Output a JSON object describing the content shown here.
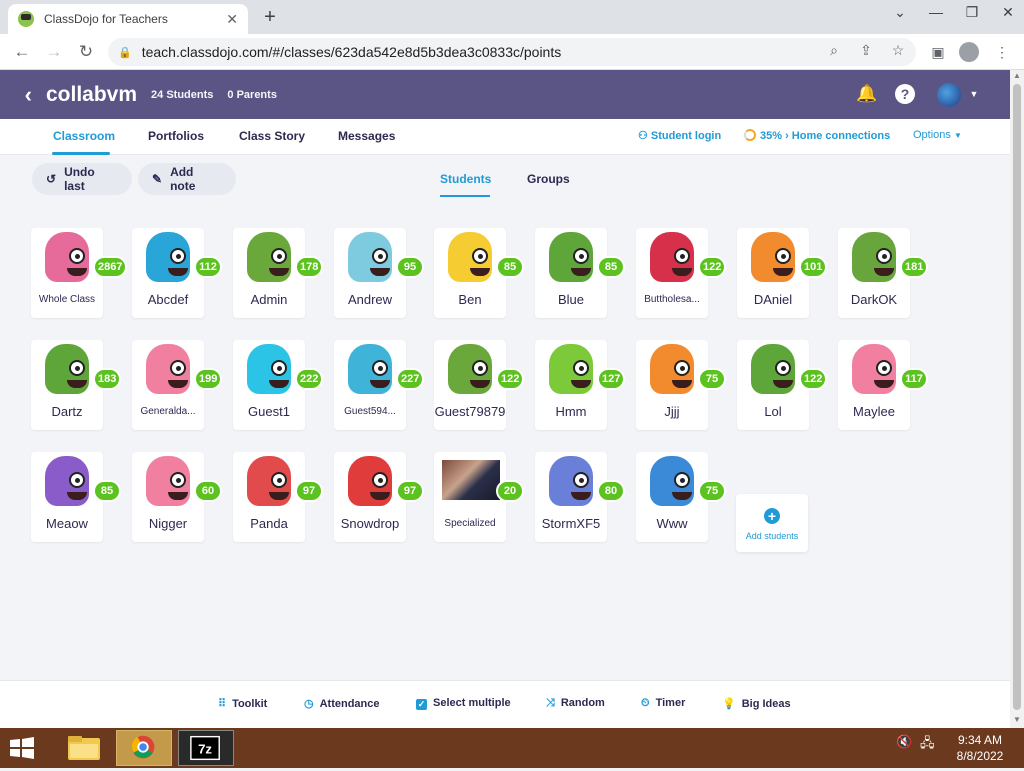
{
  "browser": {
    "tab_title": "ClassDojo for Teachers",
    "url": "teach.classdojo.com/#/classes/623da542e8d5b3dea3c0833c/points"
  },
  "app": {
    "class_name": "collabvm",
    "students_count": "24 Students",
    "parents_count": "0 Parents"
  },
  "nav": {
    "classroom": "Classroom",
    "portfolios": "Portfolios",
    "class_story": "Class Story",
    "messages": "Messages",
    "student_login": "Student login",
    "home_connections": "35% › Home connections",
    "options": "Options"
  },
  "actions": {
    "undo": "Undo last",
    "add_note": "Add note",
    "students_tab": "Students",
    "groups_tab": "Groups"
  },
  "students": [
    {
      "name": "Whole Class",
      "points": "2867",
      "color": "#e76b9a"
    },
    {
      "name": "Abcdef",
      "points": "112",
      "color": "#2aa5d8"
    },
    {
      "name": "Admin",
      "points": "178",
      "color": "#6aa83b"
    },
    {
      "name": "Andrew",
      "points": "95",
      "color": "#7ecbe0"
    },
    {
      "name": "Ben",
      "points": "85",
      "color": "#f6cc33"
    },
    {
      "name": "Blue",
      "points": "85",
      "color": "#5fa63a"
    },
    {
      "name": "Buttholesa...",
      "points": "122",
      "color": "#d6304a"
    },
    {
      "name": "DAniel",
      "points": "101",
      "color": "#f28a2e"
    },
    {
      "name": "DarkOK",
      "points": "181",
      "color": "#68a63d"
    },
    {
      "name": "Dartz",
      "points": "183",
      "color": "#5fa63a"
    },
    {
      "name": "Generalda...",
      "points": "199",
      "color": "#f07fa0"
    },
    {
      "name": "Guest1",
      "points": "222",
      "color": "#2bc4e6"
    },
    {
      "name": "Guest594...",
      "points": "227",
      "color": "#3fb4d8"
    },
    {
      "name": "Guest79879",
      "points": "122",
      "color": "#6aa83b"
    },
    {
      "name": "Hmm",
      "points": "127",
      "color": "#7cc93a"
    },
    {
      "name": "Jjjj",
      "points": "75",
      "color": "#f28a2e"
    },
    {
      "name": "Lol",
      "points": "122",
      "color": "#5fa63a"
    },
    {
      "name": "Maylee",
      "points": "117",
      "color": "#f07fa0"
    },
    {
      "name": "Meaow",
      "points": "85",
      "color": "#8a5cc9"
    },
    {
      "name": "Nigger",
      "points": "60",
      "color": "#f07fa0"
    },
    {
      "name": "Panda",
      "points": "97",
      "color": "#e24b4b"
    },
    {
      "name": "Snowdrop",
      "points": "97",
      "color": "#e03c3c"
    },
    {
      "name": "Specialized",
      "points": "20",
      "color": "photo"
    },
    {
      "name": "StormXF5",
      "points": "80",
      "color": "#6a7fd8"
    },
    {
      "name": "Www",
      "points": "75",
      "color": "#3a8ad8"
    }
  ],
  "add_students": "Add students",
  "bottom": {
    "toolkit": "Toolkit",
    "attendance": "Attendance",
    "select_multiple": "Select multiple",
    "random": "Random",
    "timer": "Timer",
    "big_ideas": "Big Ideas"
  },
  "taskbar": {
    "time": "9:34 AM",
    "date": "8/8/2022"
  }
}
